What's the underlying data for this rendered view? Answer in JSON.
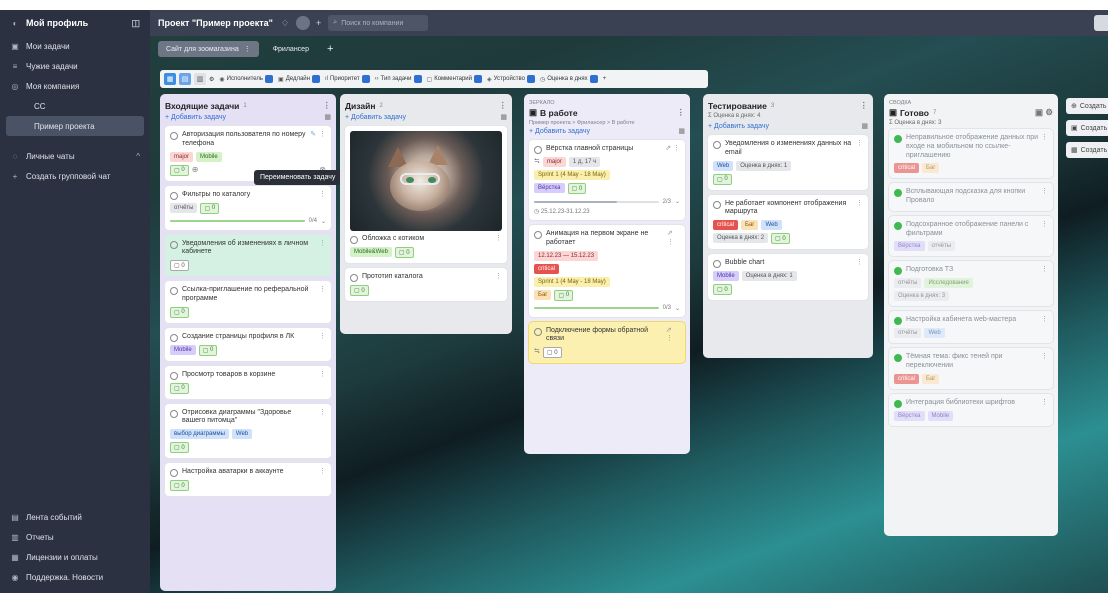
{
  "sidebar": {
    "profile": "Мой профиль",
    "items": [
      "Мои задачи",
      "Чужие задачи",
      "Моя компания"
    ],
    "company_sub": [
      "СС",
      "Пример проекта"
    ],
    "chats": "Личные чаты",
    "create_group": "Создать групповой чат",
    "bottom": [
      "Лента событий",
      "Отчеты",
      "Лицензии и оплаты",
      "Поддержка. Новости"
    ]
  },
  "topbar": {
    "project_title": "Проект \"Пример проекта\"",
    "search_placeholder": "Поиск по компании"
  },
  "tabs": [
    {
      "label": "Сайт для зоомагазина"
    },
    {
      "label": "Фрилансер"
    }
  ],
  "filters": [
    "Исполнитель",
    "Дедлайн",
    "Приоритет",
    "Тип задачи",
    "Комментарий",
    "Устройство",
    "Оценка в днях"
  ],
  "columns": {
    "inbox": {
      "title": "Входящие задачи",
      "count": "1",
      "add": "+ Добавить задачу",
      "cards": [
        {
          "title": "Авторизация пользователя по номеру телефона",
          "tags": [
            "major",
            "Mobile"
          ],
          "comments": "0"
        },
        {
          "title": "Фильтры по каталогу",
          "tags": [
            "отчёты"
          ],
          "comments": "0",
          "progress": "0/4"
        },
        {
          "title": "Уведомления об изменениях в личном кабинете",
          "comments": "0"
        },
        {
          "title": "Ссылка-приглашение по реферальной программе",
          "comments": "0"
        },
        {
          "title": "Создание страницы профиля в ЛК",
          "tags": [
            "Mobile"
          ],
          "comments": "0"
        },
        {
          "title": "Просмотр товаров в корзине",
          "comments": "0"
        },
        {
          "title": "Отрисовка диаграммы \"Здоровье вашего питомца\"",
          "tags": [
            "выбор диаграммы",
            "Web"
          ],
          "comments": "0"
        },
        {
          "title": "Настройка аватарки в аккаунте",
          "comments": "0"
        }
      ]
    },
    "design": {
      "title": "Дизайн",
      "count": "2",
      "add": "+ Добавить задачу",
      "cards": [
        {
          "title": "Обложка с котиком",
          "tags": [
            "Mobile&Web"
          ],
          "comments": "0"
        },
        {
          "title": "Прототип каталога",
          "comments": "0"
        }
      ]
    },
    "inwork": {
      "label": "ЗЕРКАЛО",
      "title": "В работе",
      "path": "Пример проекта > Фрилансер > В работе",
      "add": "+ Добавить задачу",
      "cards": [
        {
          "title": "Вёрстка главной страницы",
          "tags": [
            "major",
            "1 д, 17 ч"
          ],
          "sprint": "Sprint 1 (4 May - 18 May)",
          "tags2": [
            "Вёрстка"
          ],
          "comments": "0",
          "progress": "2/3",
          "dates": "25.12.23-31.12.23"
        },
        {
          "title": "Анимация на первом экране не работает",
          "dates": "12.12.23 — 15.12.23",
          "tags": [
            "critical"
          ],
          "sprint": "Sprint 1 (4 May - 18 May)",
          "tags2": [
            "Баг"
          ],
          "comments": "0",
          "progress": "0/3"
        },
        {
          "title": "Подключение формы обратной связи",
          "comments": "0"
        }
      ]
    },
    "testing": {
      "title": "Тестирование",
      "count": "3",
      "meta": "Σ Оценка в днях: 4",
      "add": "+ Добавить задачу",
      "cards": [
        {
          "title": "Уведомления о изменениях данных на email",
          "tags": [
            "Web",
            "Оценка в днях: 1"
          ],
          "comments": "0"
        },
        {
          "title": "Не работает компонент отображения маршрута",
          "tags": [
            "critical",
            "Баг",
            "Web",
            "Оценка в днях: 2"
          ],
          "comments": "0"
        },
        {
          "title": "Bubble chart",
          "tags": [
            "Mobile",
            "Оценка в днях: 1"
          ],
          "comments": "0"
        }
      ]
    },
    "done": {
      "label": "СВОДКА",
      "title": "Готово",
      "count": "7",
      "meta": "Σ Оценка в днях: 3",
      "cards": [
        {
          "title": "Неправильное отображение данных при входе на мобильном по ссылке-приглашению",
          "tags": [
            "critical",
            "Баг"
          ]
        },
        {
          "title": "Всплывающая подсказка для кнопки Провало",
          "tags": []
        },
        {
          "title": "Подсохранное отображение панели с фильтрами",
          "tags": [
            "Вёрстка",
            "отчёты"
          ]
        },
        {
          "title": "Подготовка ТЗ",
          "tags": [
            "отчёты",
            "Исследование",
            "Оценка в днях: 3"
          ]
        },
        {
          "title": "Настройка кабинета web-мастера",
          "tags": [
            "отчёты",
            "Web"
          ]
        },
        {
          "title": "Тёмная тема: фикс теней при переключении",
          "tags": [
            "critical",
            "Баг"
          ]
        },
        {
          "title": "Интеграция библиотеки шрифтов",
          "tags": [
            "Вёрстка",
            "Mobile"
          ]
        }
      ]
    }
  },
  "tooltip": "Переименовать задачу",
  "right_buttons": [
    "Создать",
    "Создать",
    "Создать"
  ],
  "colors": {
    "sidebar": "#2b3140",
    "accent": "#2f6fd3",
    "critical": "#e6534f",
    "ok": "#3fb950"
  }
}
